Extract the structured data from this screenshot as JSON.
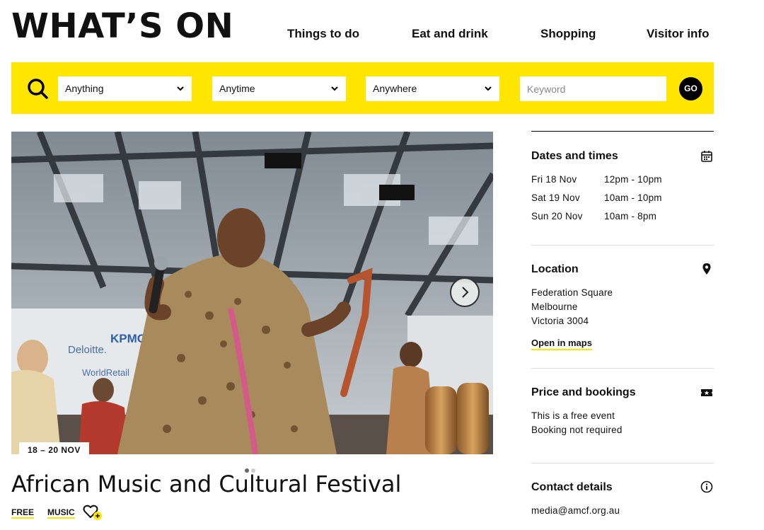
{
  "site": {
    "logo": "WHAT’S ON"
  },
  "nav": [
    {
      "label": "Things to do"
    },
    {
      "label": "Eat and drink"
    },
    {
      "label": "Shopping"
    },
    {
      "label": "Visitor info"
    }
  ],
  "search": {
    "filters": [
      {
        "label": "Anything"
      },
      {
        "label": "Anytime"
      },
      {
        "label": "Anywhere"
      }
    ],
    "keyword_placeholder": "Keyword",
    "keyword_value": "",
    "go_label": "GO"
  },
  "hero": {
    "date_badge": "18 – 20 NOV",
    "slide_count": 2,
    "current_slide": 1
  },
  "event": {
    "title": "African Music and Cultural Festival",
    "tags": [
      "FREE",
      "MUSIC"
    ]
  },
  "sidebar": {
    "dates": {
      "heading": "Dates and times",
      "rows": [
        {
          "day": "Fri 18 Nov",
          "time": "12pm - 10pm"
        },
        {
          "day": "Sat 19 Nov",
          "time": "10am - 10pm"
        },
        {
          "day": "Sun 20 Nov",
          "time": "10am - 8pm"
        }
      ]
    },
    "location": {
      "heading": "Location",
      "lines": [
        "Federation Square",
        "Melbourne",
        "Victoria 3004"
      ],
      "maps_link": "Open in maps"
    },
    "price": {
      "heading": "Price and bookings",
      "lines": [
        "This is a free event",
        "Booking not required"
      ]
    },
    "contact": {
      "heading": "Contact details",
      "email": "media@amcf.org.au"
    }
  },
  "colors": {
    "accent": "#ffe600",
    "text": "#111111"
  }
}
